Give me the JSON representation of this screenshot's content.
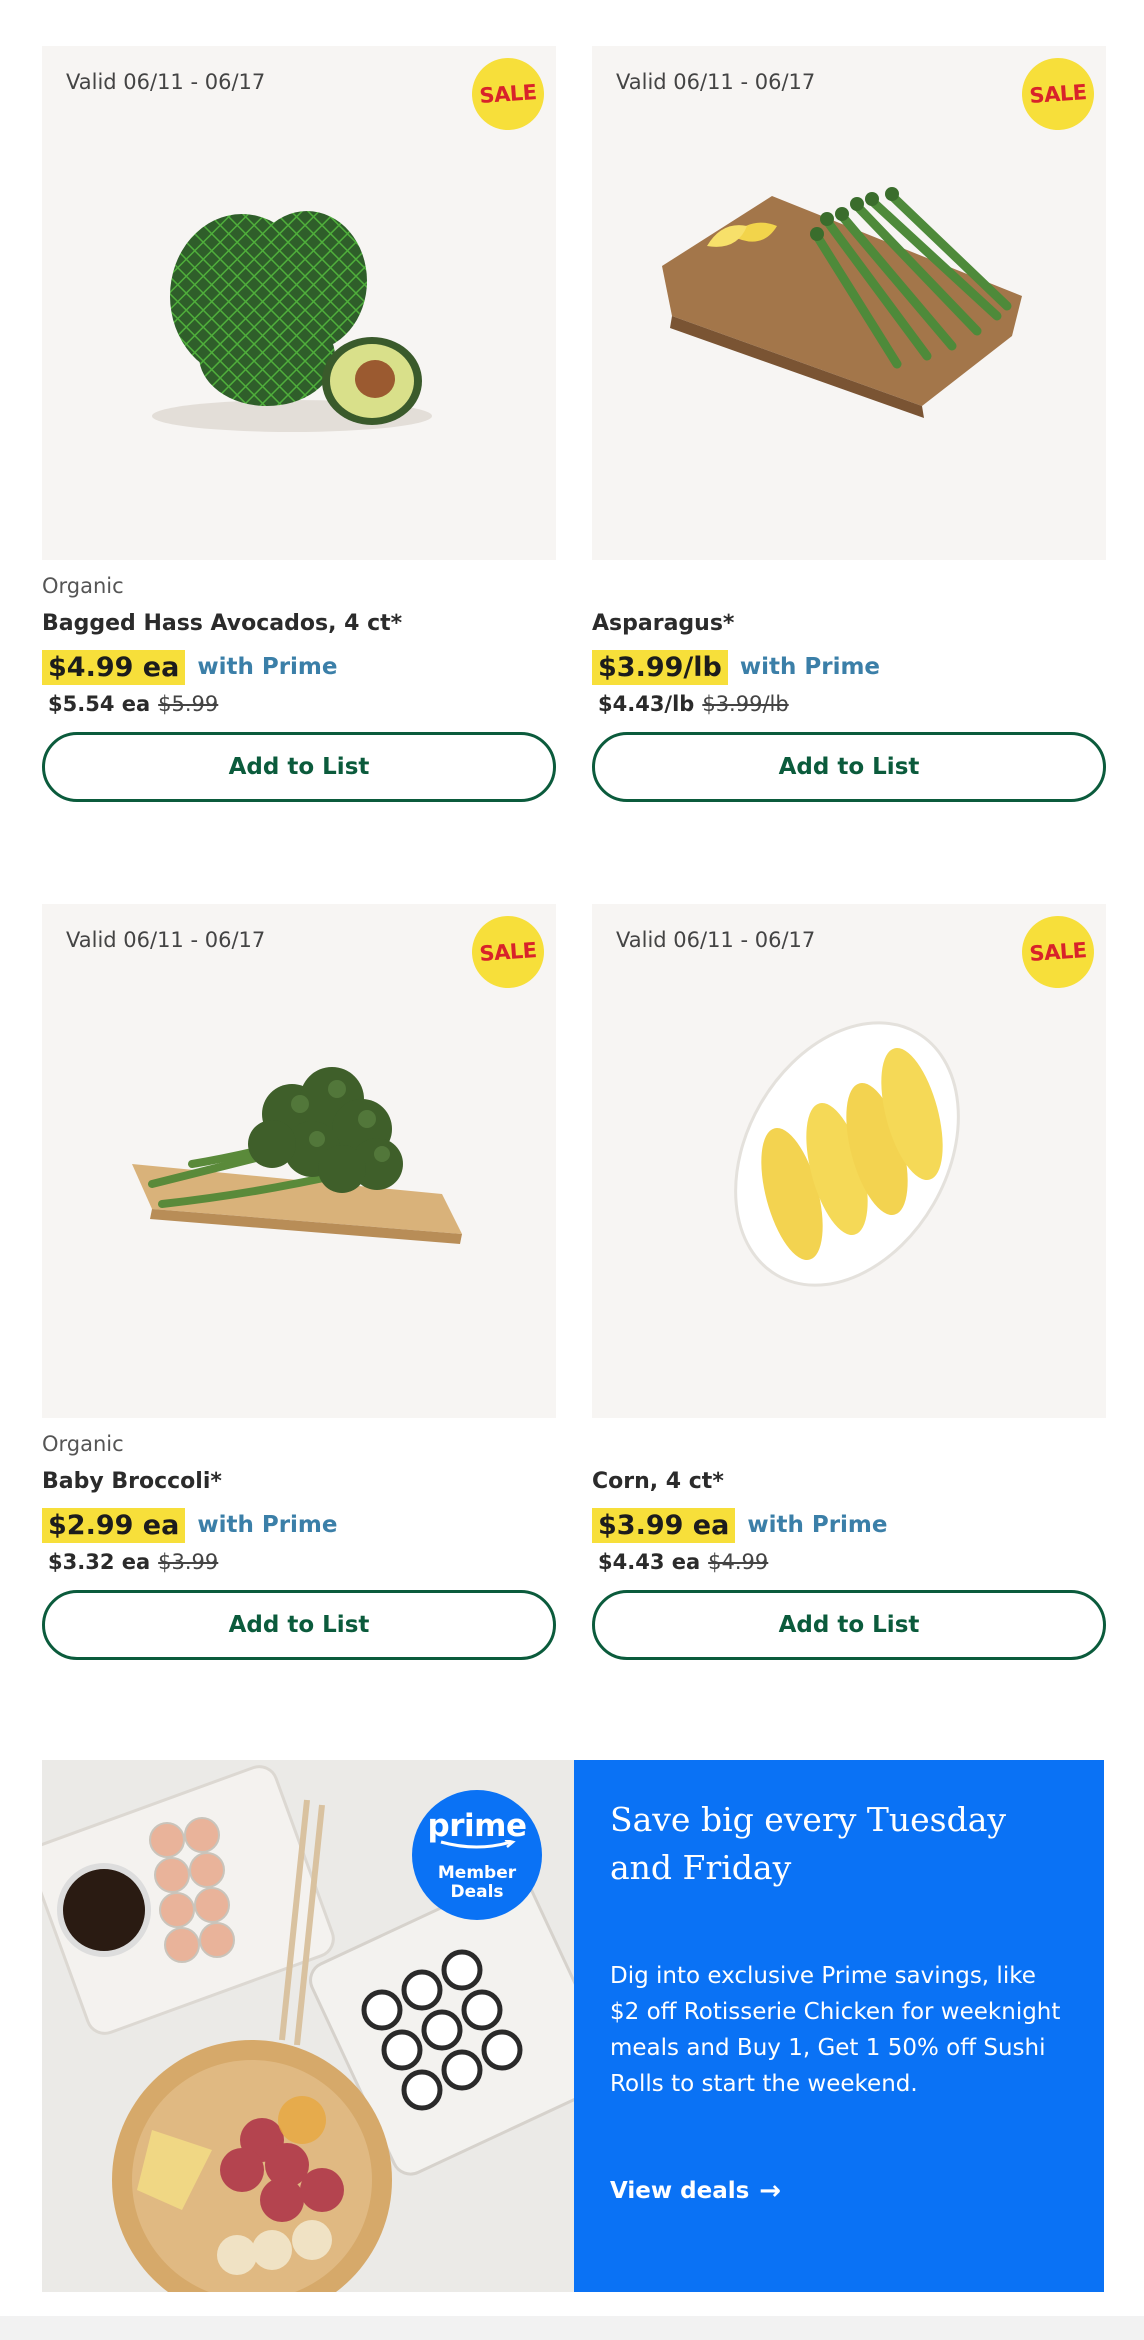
{
  "products": [
    {
      "valid": "Valid 06/11 - 06/17",
      "badge": "SALE",
      "brand": "Organic",
      "name": "Bagged Hass Avocados, 4 ct*",
      "prime_price": "$4.99 ea",
      "prime_label": "with Prime",
      "regular_price": "$5.54 ea",
      "original_price": "$5.99",
      "button": "Add to List",
      "image": "avocado-bag-image"
    },
    {
      "valid": "Valid 06/11 - 06/17",
      "badge": "SALE",
      "brand": "",
      "name": "Asparagus*",
      "prime_price": "$3.99/lb",
      "prime_label": "with Prime",
      "regular_price": "$4.43/lb",
      "original_price": "$3.99/lb",
      "button": "Add to List",
      "image": "asparagus-image"
    },
    {
      "valid": "Valid 06/11 - 06/17",
      "badge": "SALE",
      "brand": "Organic",
      "name": "Baby Broccoli*",
      "prime_price": "$2.99 ea",
      "prime_label": "with Prime",
      "regular_price": "$3.32 ea",
      "original_price": "$3.99",
      "button": "Add to List",
      "image": "broccoli-image"
    },
    {
      "valid": "Valid 06/11 - 06/17",
      "badge": "SALE",
      "brand": "",
      "name": "Corn, 4 ct*",
      "prime_price": "$3.99 ea",
      "prime_label": "with Prime",
      "regular_price": "$4.43 ea",
      "original_price": "$4.99",
      "button": "Add to List",
      "image": "corn-image"
    }
  ],
  "promo": {
    "badge_word": "prime",
    "badge_line1": "Member",
    "badge_line2": "Deals",
    "title": "Save big every Tuesday and Friday",
    "body": "Dig into exclusive Prime savings, like $2 off Rotisserie Chicken for weeknight meals and Buy 1, Get 1 50% off Sushi Rolls to start the weekend.",
    "cta": "View deals",
    "cta_icon": "arrow-right-icon"
  },
  "colors": {
    "highlight": "#f7df3a",
    "sale_text": "#d8232a",
    "button_green": "#0b5b3c",
    "prime_blue_text": "#3b7fa8",
    "promo_blue": "#0a72f5"
  }
}
